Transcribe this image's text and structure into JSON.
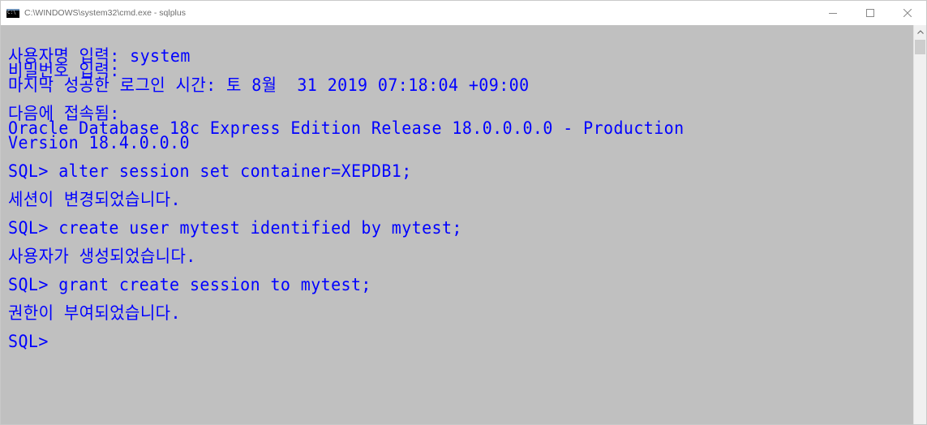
{
  "window": {
    "title": "C:\\WINDOWS\\system32\\cmd.exe - sqlplus",
    "icon": "cmd-console-icon",
    "controls": {
      "minimize_glyph": "—",
      "maximize_glyph": "☐",
      "close_glyph": "✕"
    }
  },
  "console": {
    "text_color": "#0000ff",
    "background_color": "#c0c0c0",
    "lines": [
      "사용자명 입력: system",
      "비밀번호 입력:",
      "마지막 성공한 로그인 시간: 토 8월  31 2019 07:18:04 +09:00",
      "",
      "다음에 접속됨:",
      "Oracle Database 18c Express Edition Release 18.0.0.0.0 - Production",
      "Version 18.4.0.0.0",
      "",
      "SQL> alter session set container=XEPDB1;",
      "",
      "세션이 변경되었습니다.",
      "",
      "SQL> create user mytest identified by mytest;",
      "",
      "사용자가 생성되었습니다.",
      "",
      "SQL> grant create session to mytest;",
      "",
      "권한이 부여되었습니다.",
      "",
      "SQL>"
    ]
  },
  "scrollbar": {
    "up_arrow_glyph": "^"
  }
}
